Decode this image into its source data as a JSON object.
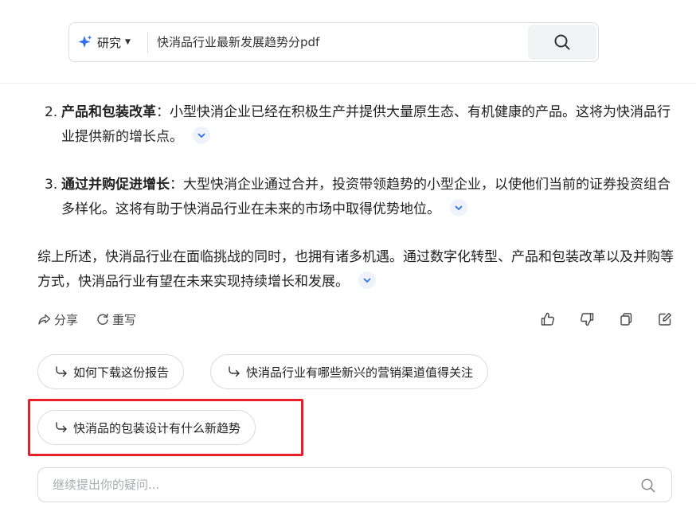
{
  "search": {
    "mode_label": "研究",
    "query": "快消品行业最新发展趋势分pdf",
    "icons": {
      "mode": "sparkle-icon",
      "mode_caret": "caret-down-icon",
      "submit": "search-icon"
    }
  },
  "answer": {
    "items": [
      {
        "number": "2.",
        "title": "产品和包装改革",
        "text": "：小型快消企业已经在积极生产并提供大量原生态、有机健康的产品。这将为快消品行业提供新的增长点。"
      },
      {
        "number": "3.",
        "title": "通过并购促进增长",
        "text": "：大型快消企业通过合并，投资带领趋势的小型企业，以使他们当前的证券投资组合多样化。这将有助于快消品行业在未来的市场中取得优势地位。"
      }
    ],
    "summary": "综上所述，快消品行业在面临挑战的同时，也拥有诸多机遇。通过数字化转型、产品和包装改革以及并购等方式，快消品行业有望在未来实现持续增长和发展。",
    "expand_icon": "chevron-down-icon"
  },
  "actions": {
    "share_label": "分享",
    "regenerate_label": "重写",
    "icons": [
      "thumbs-up-icon",
      "thumbs-down-icon",
      "copy-icon",
      "edit-icon"
    ]
  },
  "suggestions": [
    "如何下载这份报告",
    "快消品行业有哪些新兴的营销渠道值得关注",
    "快消品的包装设计有什么新趋势"
  ],
  "followup": {
    "placeholder": "继续提出你的疑问..."
  },
  "colors": {
    "accent": "#2f6ff2",
    "highlight": "#e8202a",
    "chip_bg": "#eef2fb"
  }
}
